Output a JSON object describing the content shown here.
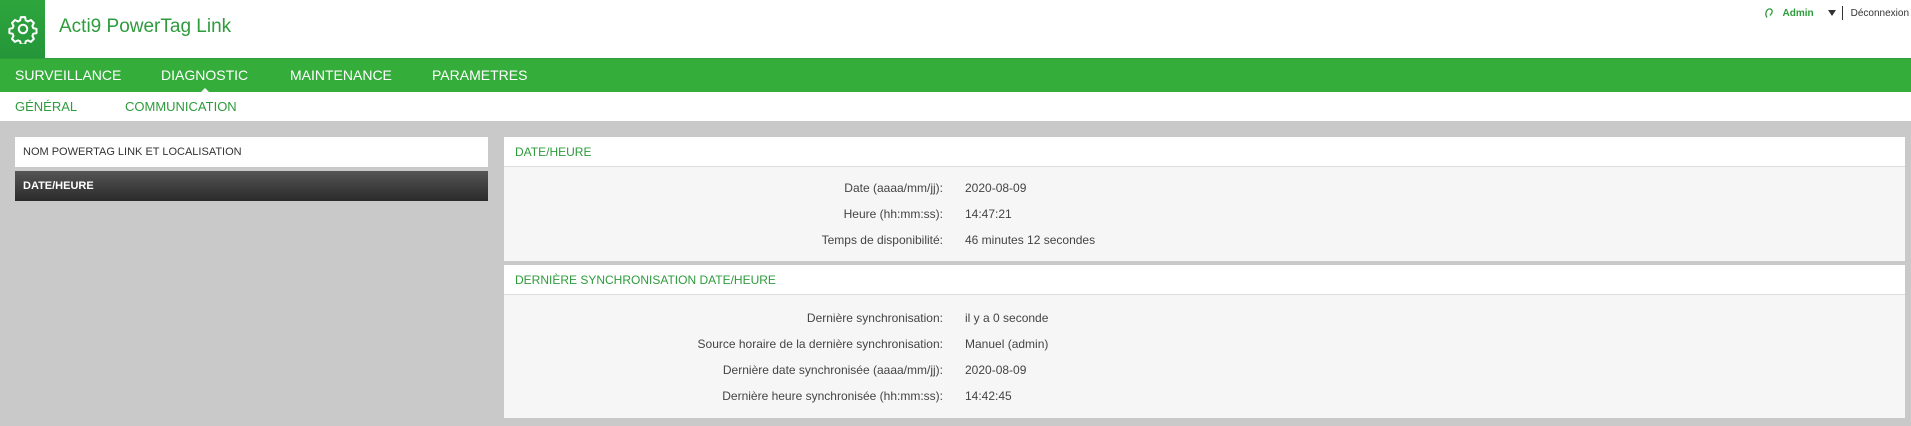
{
  "app": {
    "title": "Acti9 PowerTag Link",
    "logo_icon": "gear-icon",
    "user_icon": "user-icon",
    "user_name": "Admin",
    "logout_label": "Déconnexion",
    "colors": {
      "brand_green": "#34ad3b",
      "text_green": "#2e9b3c"
    }
  },
  "mainnav": {
    "items": [
      {
        "label": "SURVEILLANCE"
      },
      {
        "label": "DIAGNOSTIC"
      },
      {
        "label": "MAINTENANCE"
      },
      {
        "label": "PARAMETRES"
      }
    ],
    "active": "DIAGNOSTIC"
  },
  "subnav": {
    "items": [
      {
        "label": "GÉNÉRAL"
      },
      {
        "label": "COMMUNICATION"
      }
    ],
    "active": "GÉNÉRAL"
  },
  "sidebar": {
    "items": [
      {
        "label": "NOM POWERTAG LINK ET LOCALISATION"
      },
      {
        "label": "DATE/HEURE"
      }
    ],
    "active": "DATE/HEURE"
  },
  "datetime_panel": {
    "title": "DATE/HEURE",
    "rows": [
      {
        "label": "Date (aaaa/mm/jj):",
        "value": "2020-08-09"
      },
      {
        "label": "Heure (hh:mm:ss):",
        "value": "14:47:21"
      },
      {
        "label": "Temps de disponibilité:",
        "value": "46 minutes 12 secondes"
      }
    ]
  },
  "sync_panel": {
    "title": "DERNIÈRE SYNCHRONISATION DATE/HEURE",
    "rows": [
      {
        "label": "Dernière synchronisation:",
        "value": "il y a 0 seconde"
      },
      {
        "label": "Source horaire de la dernière synchronisation:",
        "value": "Manuel (admin)"
      },
      {
        "label": "Dernière date synchronisée (aaaa/mm/jj):",
        "value": "2020-08-09"
      },
      {
        "label": "Dernière heure synchronisée (hh:mm:ss):",
        "value": "14:42:45"
      }
    ]
  }
}
